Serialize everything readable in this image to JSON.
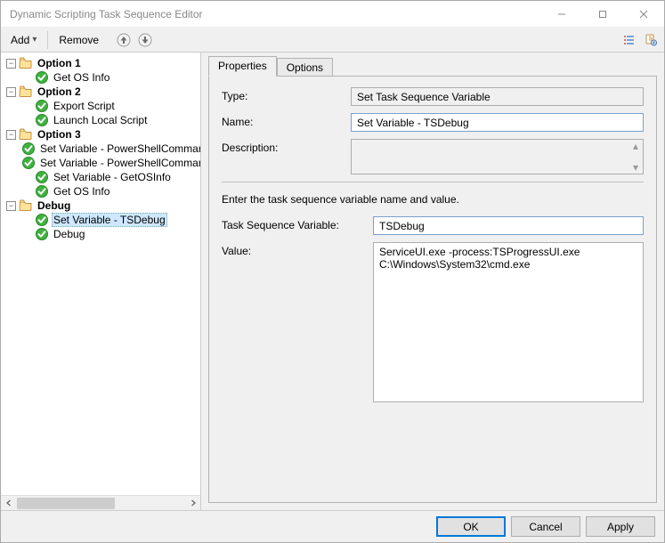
{
  "window": {
    "title": "Dynamic Scripting Task Sequence Editor"
  },
  "toolbar": {
    "add_label": "Add",
    "remove_label": "Remove"
  },
  "tree": {
    "groups": [
      {
        "label": "Option 1",
        "items": [
          {
            "label": "Get OS Info"
          }
        ]
      },
      {
        "label": "Option 2",
        "items": [
          {
            "label": "Export Script"
          },
          {
            "label": "Launch Local Script"
          }
        ]
      },
      {
        "label": "Option 3",
        "items": [
          {
            "label": "Set Variable - PowerShellCommand"
          },
          {
            "label": "Set Variable - PowerShellCommand"
          },
          {
            "label": "Set Variable - GetOSInfo"
          },
          {
            "label": "Get OS Info"
          }
        ]
      },
      {
        "label": "Debug",
        "items": [
          {
            "label": "Set Variable - TSDebug",
            "selected": true
          },
          {
            "label": "Debug"
          }
        ]
      }
    ]
  },
  "tabs": {
    "properties": "Properties",
    "options": "Options"
  },
  "form": {
    "type_label": "Type:",
    "type_value": "Set Task Sequence Variable",
    "name_label": "Name:",
    "name_value": "Set Variable - TSDebug",
    "description_label": "Description:",
    "description_value": "",
    "hint": "Enter the task sequence variable name and value.",
    "tsvar_label": "Task Sequence Variable:",
    "tsvar_value": "TSDebug",
    "value_label": "Value:",
    "value_text": "ServiceUI.exe -process:TSProgressUI.exe C:\\Windows\\System32\\cmd.exe"
  },
  "footer": {
    "ok": "OK",
    "cancel": "Cancel",
    "apply": "Apply"
  }
}
